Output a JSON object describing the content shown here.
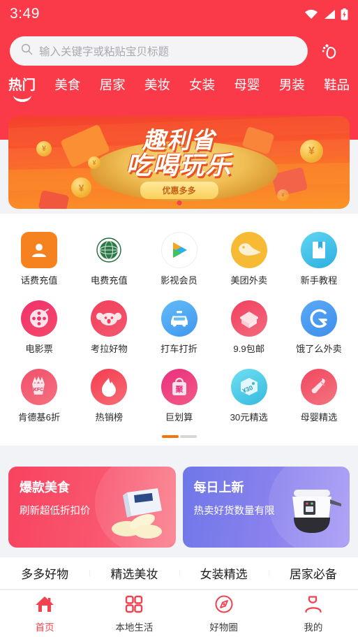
{
  "status_bar": {
    "time": "3:49",
    "icons": [
      "wifi-icon",
      "cellular-signal-icon",
      "battery-charging-icon"
    ]
  },
  "search": {
    "placeholder": "输入关键字或粘贴宝贝标题",
    "search_icon": "search-icon",
    "action_icon": "footprint-icon"
  },
  "categories": [
    {
      "label": "热门",
      "active": true
    },
    {
      "label": "美食",
      "active": false
    },
    {
      "label": "居家",
      "active": false
    },
    {
      "label": "美妆",
      "active": false
    },
    {
      "label": "女装",
      "active": false
    },
    {
      "label": "母婴",
      "active": false
    },
    {
      "label": "男装",
      "active": false
    },
    {
      "label": "鞋品",
      "active": false
    }
  ],
  "banner": {
    "title_line1": "趣利省",
    "title_line2": "吃喝玩乐",
    "button_label": "优惠多多",
    "coin_symbol": "¥"
  },
  "grid": {
    "rows": [
      [
        {
          "label": "话费充值",
          "icon": "phone-recharge-icon",
          "color": "#f5821f"
        },
        {
          "label": "电费充值",
          "icon": "state-grid-icon",
          "color": "#1f6b3b"
        },
        {
          "label": "影视会员",
          "icon": "tencent-video-icon",
          "color": "#2ab1e8"
        },
        {
          "label": "美团外卖",
          "icon": "meituan-kangaroo-icon",
          "color": "#f7ba35"
        },
        {
          "label": "新手教程",
          "icon": "tutorial-book-icon",
          "color": "#3cc3e8"
        }
      ],
      [
        {
          "label": "电影票",
          "icon": "film-reel-icon",
          "color": "#f23a6a"
        },
        {
          "label": "考拉好物",
          "icon": "koala-icon",
          "color": "#f2405c"
        },
        {
          "label": "打车打折",
          "icon": "taxi-icon",
          "color": "#4aa8f5"
        },
        {
          "label": "9.9包邮",
          "icon": "package-box-icon",
          "color": "#f4566c"
        },
        {
          "label": "饿了么外卖",
          "icon": "eleme-icon",
          "color": "#4a9df2"
        }
      ],
      [
        {
          "label": "肯德基6折",
          "icon": "kfc-fries-icon",
          "color": "#f3566e"
        },
        {
          "label": "热销榜",
          "icon": "flame-icon",
          "color": "#f4475a"
        },
        {
          "label": "巨划算",
          "icon": "shopping-bag-icon",
          "color": "#ea3b7a"
        },
        {
          "label": "30元精选",
          "icon": "coupon-tag-icon",
          "color": "#45cbe8"
        },
        {
          "label": "母婴精选",
          "icon": "baby-bottle-icon",
          "color": "#f2556b"
        }
      ]
    ],
    "pager": {
      "total": 2,
      "current": 1
    }
  },
  "promos": [
    {
      "title": "爆款美食",
      "subtitle": "刷新超低折扣价",
      "image": "snack-box-image",
      "theme": "#f8435f"
    },
    {
      "title": "每日上新",
      "subtitle": "热卖好货数量有限",
      "image": "rice-cooker-image",
      "theme": "#6f77e8"
    }
  ],
  "content_tabs": [
    {
      "label": "多多好物"
    },
    {
      "label": "精选美妆"
    },
    {
      "label": "女装精选"
    },
    {
      "label": "居家必备"
    }
  ],
  "bottom_nav": [
    {
      "label": "首页",
      "icon": "home-icon",
      "active": true
    },
    {
      "label": "本地生活",
      "icon": "grid-squares-icon",
      "active": false
    },
    {
      "label": "好物圈",
      "icon": "compass-icon",
      "active": false
    },
    {
      "label": "我的",
      "icon": "user-profile-icon",
      "active": false
    }
  ],
  "colors": {
    "header_red": "#fa3a48",
    "accent_red": "#f2424f",
    "pager_orange": "#f2760f",
    "page_bg": "#f2f3f7"
  }
}
